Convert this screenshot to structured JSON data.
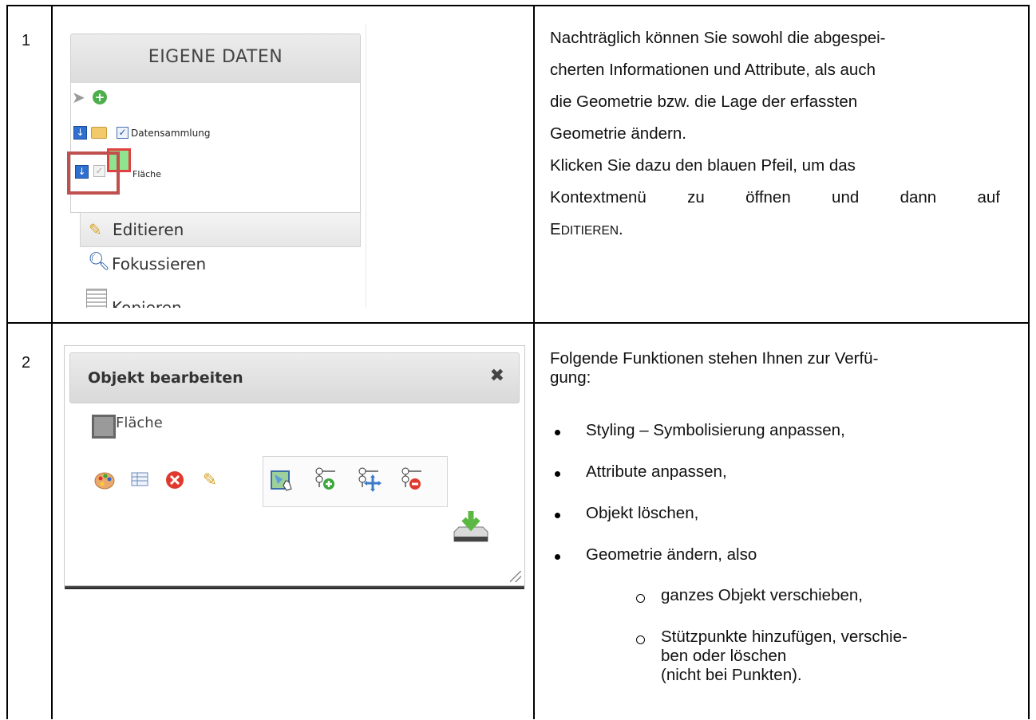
{
  "rows": [
    {
      "number": "1",
      "screenshot": {
        "header_title": "EIGENE DATEN",
        "tree": {
          "folder_label": "Datensammlung",
          "layer_label": "Fläche"
        },
        "menu": [
          {
            "label": "Editieren",
            "icon": "pencil-icon"
          },
          {
            "label": "Fokussieren",
            "icon": "magnifier-icon"
          },
          {
            "label": "Kopieren",
            "icon": "copy-icon"
          }
        ],
        "highlight_color": "#c0504d"
      },
      "text": {
        "p1_lines": [
          "Nachträglich können Sie sowohl die abgespei-",
          "cherten Informationen und Attribute, als auch",
          "die Geometrie bzw. die Lage der erfassten",
          "Geometrie ändern."
        ],
        "p2_lines": [
          "Klicken Sie dazu den blauen Pfeil, um das",
          "Kontextmenü zu öffnen und dann auf"
        ],
        "p2_end_big": "E",
        "p2_end_small": "DITIEREN",
        "p2_end_punct": "."
      }
    },
    {
      "number": "2",
      "screenshot": {
        "dialog_title": "Objekt bearbeiten",
        "close_symbol": "✖",
        "layer_label": "Fläche",
        "tool_icons": [
          "palette-icon",
          "table-icon",
          "delete-icon",
          "pencil-icon",
          "move-object-icon",
          "add-vertex-icon",
          "move-vertex-icon",
          "delete-vertex-icon",
          "save-download-icon"
        ]
      },
      "text": {
        "intro_lines": [
          "Folgende Funktionen stehen Ihnen zur Verfü-",
          "gung:"
        ],
        "bullets": [
          "Styling – Symbolisierung anpassen,",
          "Attribute anpassen,",
          "Objekt löschen,",
          "Geometrie ändern, also"
        ],
        "sub_bullets": [
          {
            "lines": [
              "ganzes Objekt verschieben,"
            ]
          },
          {
            "lines": [
              "Stützpunkte hinzufügen, verschie-",
              "ben oder löschen",
              "(nicht bei Punkten)."
            ]
          }
        ]
      }
    }
  ]
}
